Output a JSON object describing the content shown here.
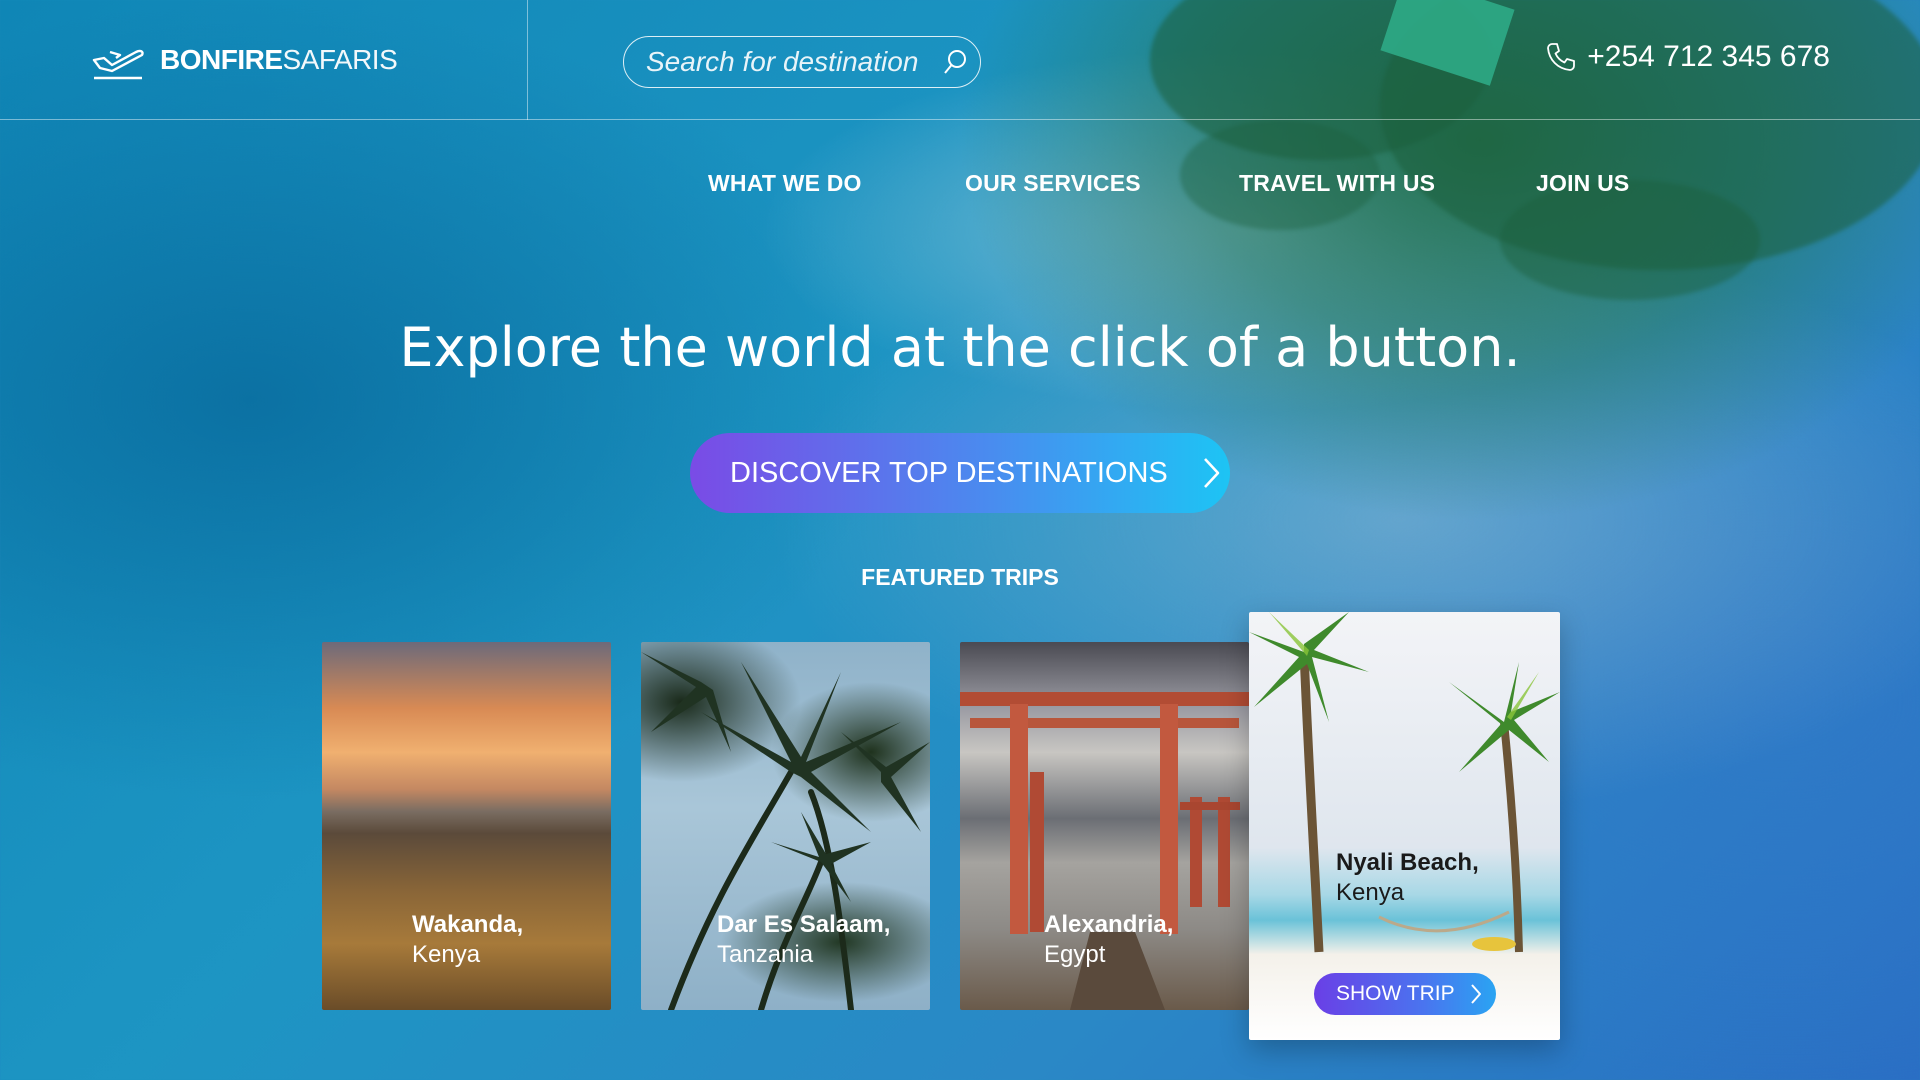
{
  "brand": {
    "name_bold": "BONFIRE",
    "name_light": "SAFARIS"
  },
  "search": {
    "placeholder": "Search for destination"
  },
  "contact": {
    "phone": "+254 712 345 678"
  },
  "nav": {
    "items": [
      {
        "label": "WHAT WE DO"
      },
      {
        "label": "OUR SERVICES"
      },
      {
        "label": "TRAVEL WITH US"
      },
      {
        "label": "JOIN US"
      }
    ]
  },
  "hero": {
    "title": "Explore the world at the click of a button.",
    "cta_label": "DISCOVER TOP DESTINATIONS"
  },
  "featured": {
    "heading": "FEATURED TRIPS",
    "trips": [
      {
        "city": "Wakanda,",
        "country": "Kenya"
      },
      {
        "city": "Dar Es Salaam,",
        "country": "Tanzania"
      },
      {
        "city": "Alexandria,",
        "country": "Egypt"
      },
      {
        "city": "Nyali Beach,",
        "country": "Kenya",
        "action_label": "SHOW TRIP"
      }
    ]
  },
  "colors": {
    "cta_gradient_start": "#7a4be6",
    "cta_gradient_end": "#1dc4f4",
    "ocean": "#1d95c3"
  },
  "icons": [
    "plane-icon",
    "search-icon",
    "phone-icon",
    "chevron-right-icon"
  ]
}
